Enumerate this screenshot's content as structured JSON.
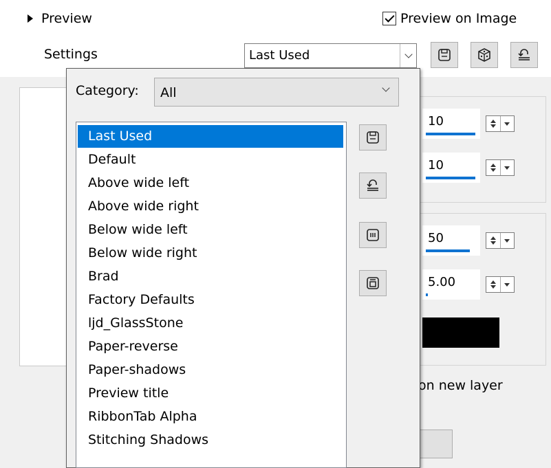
{
  "header": {
    "preview_label": "Preview",
    "preview_on_image_label": "Preview on Image",
    "preview_on_image_checked": true,
    "settings_label": "Settings",
    "settings_value": "Last Used"
  },
  "popup": {
    "category_label": "Category:",
    "category_value": "All",
    "presets": [
      "Last Used",
      "Default",
      "Above wide left",
      "Above wide right",
      "Below wide left",
      "Below wide right",
      "Brad",
      "Factory Defaults",
      "ljd_GlassStone",
      "Paper-reverse",
      "Paper-shadows",
      "Preview title",
      "RibbonTab Alpha",
      "Stitching Shadows"
    ],
    "selected_preset": "Last Used"
  },
  "background": {
    "spin1_value": "10",
    "spin2_value": "10",
    "spin3_value": "50",
    "spin4_value": "5.00",
    "new_layer_label": "on new layer",
    "color_swatch": "#000000"
  },
  "colors": {
    "accent": "#0078d7",
    "slider_bar": "#0f73d1"
  }
}
